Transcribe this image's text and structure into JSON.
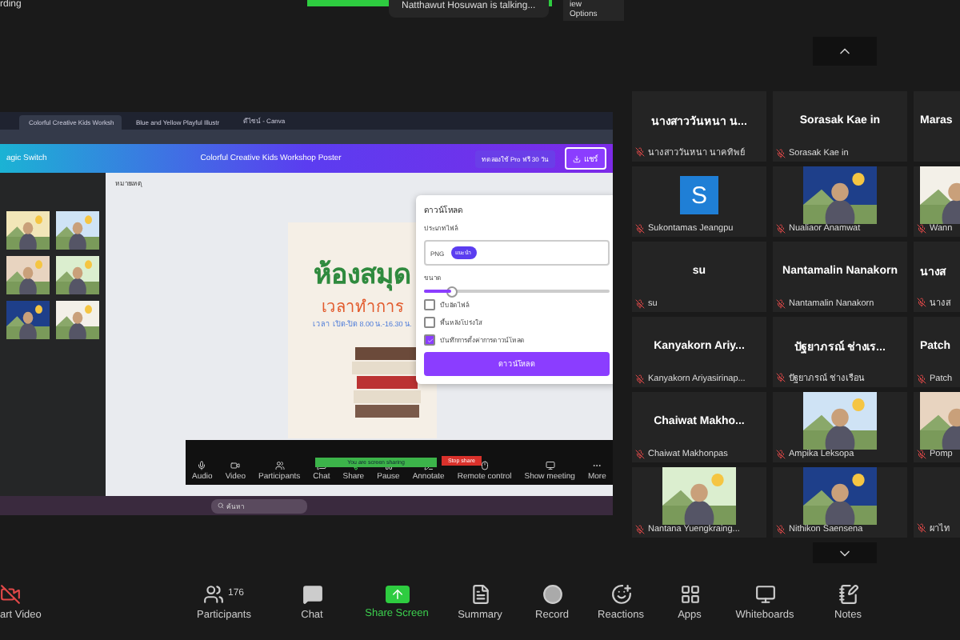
{
  "top_banners": {
    "recording": "rding",
    "talking": "Natthawut Hosuwan is talking...",
    "view_options": "iew Options"
  },
  "shared_screen": {
    "browser_tabs": [
      {
        "title": "Colorful Creative Kids Worksh",
        "selected": true
      },
      {
        "title": "Blue and Yellow Playful Illustr",
        "selected": false
      },
      {
        "title": "ดีไซน์ - Canva",
        "selected": false
      }
    ],
    "editor": {
      "magic_switch": "agic Switch",
      "design_title": "Colorful Creative Kids Workshop Poster",
      "pro_trial": "ทดลองใช้ Pro ฟรี 30 วัน",
      "share": "แชร์",
      "notes": "หมายเหตุ"
    },
    "poster": {
      "title": "ห้องสมุด",
      "subtitle": "เวลาทำการ",
      "hours": "เวลา เปิด-ปิด 8.00 น.-16.30 น."
    },
    "download_panel": {
      "title": "ดาวน์โหลด",
      "file_type_label": "ประเภทไฟล์",
      "file_type": "PNG",
      "badge": "แนะนำ",
      "size_label": "ขนาด",
      "size_slider": {
        "level": 0.15
      },
      "options": [
        {
          "label": "บีบอัดไฟล์",
          "checked": false
        },
        {
          "label": "พื้นหลังโปร่งใส",
          "checked": false
        },
        {
          "label": "บันทึกการตั้งค่าการดาวน์โหลด",
          "checked": true
        }
      ],
      "button": "ดาวน์โหลด"
    },
    "share_bar": {
      "status": "You are screen sharing",
      "stop": "Stop share",
      "items": [
        {
          "label": "Audio"
        },
        {
          "label": "Video"
        },
        {
          "label": "Participants"
        },
        {
          "label": "Chat"
        },
        {
          "label": "Share"
        },
        {
          "label": "Pause"
        },
        {
          "label": "Annotate"
        },
        {
          "label": "Remote control"
        },
        {
          "label": "Show meeting"
        },
        {
          "label": "More"
        }
      ]
    },
    "taskbar": {
      "search": "ค้นหา"
    }
  },
  "gallery": {
    "tiles": [
      {
        "kind": "name",
        "display_name": "นางสาววันหนา น...",
        "label": "นางสาววันหนา นาคทิพย์"
      },
      {
        "kind": "name",
        "display_name": "Sorasak Kae in",
        "label": "Sorasak Kae in"
      },
      {
        "kind": "name",
        "display_name": "Maras"
      },
      {
        "kind": "avatar",
        "letter": "S",
        "color": "#1f7fd6",
        "label": "Sukontamas Jeangpu"
      },
      {
        "label": "Nualiaor Anamwat"
      },
      {
        "label": "Wann"
      },
      {
        "kind": "name",
        "display_name": "su",
        "label": "su"
      },
      {
        "kind": "name",
        "display_name": "Nantamalin Nanakorn",
        "label": "Nantamalin Nanakorn"
      },
      {
        "kind": "name",
        "display_name": "นางส",
        "label": "นางส"
      },
      {
        "kind": "name",
        "display_name": "Kanyakorn Ariy...",
        "label": "Kanyakorn Ariyasirinap..."
      },
      {
        "kind": "name",
        "display_name": "ปัฐยาภรณ์ ช่างเร...",
        "label": "ปัฐยาภรณ์ ช่างเรือน"
      },
      {
        "kind": "name",
        "display_name": "Patch",
        "label": "Patch"
      },
      {
        "kind": "name",
        "display_name": "Chaiwat Makho...",
        "label": "Chaiwat Makhonpas"
      },
      {
        "label": "Ampika Leksopa"
      },
      {
        "label": "Pomp"
      },
      {
        "label": "Nantana Yuengkraing..."
      },
      {
        "label": "Nithikon Saensena"
      },
      {
        "kind": "name",
        "label": "ผาไท"
      }
    ]
  },
  "toolbar": [
    {
      "label": "art Video",
      "kind": "button"
    },
    {
      "label": "Participants",
      "count": "176",
      "kind": "button"
    },
    {
      "label": "Chat",
      "kind": "button"
    },
    {
      "label": "Share Screen",
      "kind": "share"
    },
    {
      "label": "Summary",
      "kind": "button"
    },
    {
      "label": "Record",
      "kind": "button"
    },
    {
      "label": "Reactions",
      "kind": "button"
    },
    {
      "label": "Apps",
      "kind": "button"
    },
    {
      "label": "Whiteboards",
      "kind": "button"
    },
    {
      "label": "Notes",
      "kind": "button"
    }
  ]
}
